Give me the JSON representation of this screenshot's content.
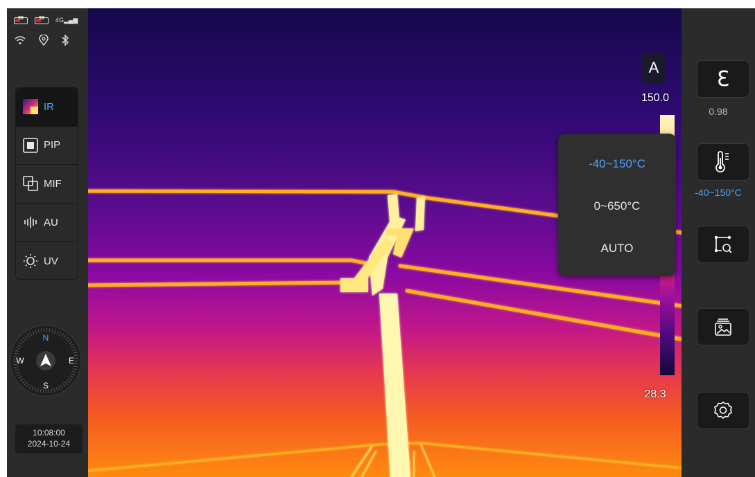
{
  "status": {
    "battery1": "99",
    "battery2": "99",
    "network": "4G"
  },
  "modes": [
    {
      "label": "IR",
      "icon": "ir-gradient-icon",
      "active": true
    },
    {
      "label": "PIP",
      "icon": "pip-icon",
      "active": false
    },
    {
      "label": "MIF",
      "icon": "mif-icon",
      "active": false
    },
    {
      "label": "AU",
      "icon": "audio-wave-icon",
      "active": false
    },
    {
      "label": "UV",
      "icon": "sun-icon",
      "active": false
    }
  ],
  "compass": {
    "n": "N",
    "e": "E",
    "s": "S",
    "w": "W"
  },
  "datetime": {
    "time": "10:08:00",
    "date": "2024-10-24"
  },
  "scale": {
    "mode": "A",
    "max": "150.0",
    "min": "28.3"
  },
  "range_menu": {
    "options": [
      "-40~150°C",
      "0~650°C",
      "AUTO"
    ],
    "selected": "-40~150°C"
  },
  "right_panel": {
    "emissivity_symbol": "Ɛ",
    "emissivity_value": "0.98",
    "range_value": "-40~150°C"
  },
  "colors": {
    "accent": "#4ea2ff",
    "panel": "#2b2b2b"
  }
}
